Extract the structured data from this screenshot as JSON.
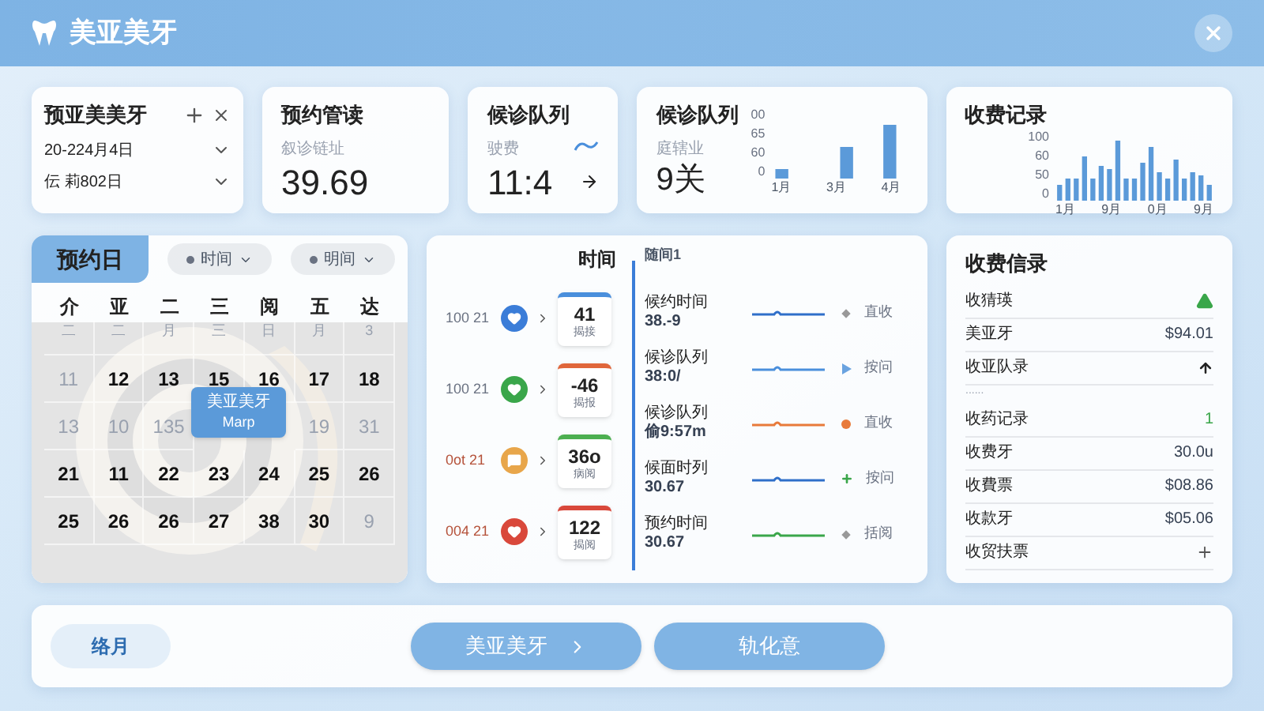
{
  "header": {
    "title": "美亚美牙"
  },
  "booking_card": {
    "title": "预亚美美牙",
    "selects": [
      {
        "value": "20-224月4日"
      },
      {
        "value": "伝 莉802日"
      }
    ]
  },
  "stat_cards": [
    {
      "title": "预约管读",
      "label": "叙诊链址",
      "value": "39.69",
      "kind": "plain"
    },
    {
      "title": "候诊队列",
      "label": "驶费",
      "value": "11:4",
      "kind": "trend"
    }
  ],
  "queue_chart": {
    "title": "候诊队列",
    "label": "庭辖业",
    "value": "9关",
    "yticks": [
      "00",
      "65",
      "60",
      "0"
    ],
    "xlabels": [
      "1月",
      "3月",
      "4月"
    ]
  },
  "fee_chart": {
    "title": "收费记录",
    "yticks": [
      "100",
      "60",
      "50",
      "0"
    ],
    "xlabels": [
      "1月",
      "9月",
      "0月",
      "9月"
    ]
  },
  "calendar": {
    "tab": "预约日",
    "filters": [
      {
        "label": "时间"
      },
      {
        "label": "明间"
      }
    ],
    "weekdays": [
      "介",
      "亚",
      "二",
      "三",
      "阅",
      "五",
      "达"
    ],
    "rows": [
      [
        {
          "text": "二",
          "muted": true,
          "kind": "small"
        },
        {
          "text": "二",
          "muted": true,
          "kind": "small"
        },
        {
          "text": "月",
          "muted": true,
          "kind": "small"
        },
        {
          "text": "三",
          "muted": true,
          "kind": "small"
        },
        {
          "text": "日",
          "muted": true,
          "kind": "small"
        },
        {
          "text": "月",
          "muted": true,
          "kind": "small"
        },
        {
          "text": "3",
          "muted": true,
          "kind": "small"
        }
      ],
      [
        {
          "text": "11",
          "muted": true,
          "kind": "date"
        },
        {
          "text": "12",
          "muted": false,
          "kind": "date"
        },
        {
          "text": "13",
          "muted": false,
          "kind": "date"
        },
        {
          "text": "15",
          "muted": false,
          "kind": "date"
        },
        {
          "text": "16",
          "muted": false,
          "kind": "date"
        },
        {
          "text": "17",
          "muted": false,
          "kind": "date"
        },
        {
          "text": "18",
          "muted": false,
          "kind": "date"
        }
      ],
      [
        {
          "text": "13",
          "muted": true,
          "kind": "date"
        },
        {
          "text": "10",
          "muted": true,
          "kind": "date"
        },
        {
          "text": "135",
          "muted": true,
          "kind": "date"
        },
        {
          "kind": "covered"
        },
        {
          "kind": "covered"
        },
        {
          "text": "19",
          "muted": true,
          "kind": "date"
        },
        {
          "text": "31",
          "muted": true,
          "kind": "date"
        }
      ],
      [
        {
          "text": "21",
          "muted": false,
          "kind": "date"
        },
        {
          "text": "11",
          "muted": false,
          "kind": "date"
        },
        {
          "text": "22",
          "muted": false,
          "kind": "date"
        },
        {
          "text": "23",
          "muted": false,
          "kind": "date"
        },
        {
          "text": "24",
          "muted": false,
          "kind": "date"
        },
        {
          "text": "25",
          "muted": false,
          "kind": "date"
        },
        {
          "text": "26",
          "muted": false,
          "kind": "date"
        }
      ],
      [
        {
          "text": "25",
          "muted": false,
          "kind": "date"
        },
        {
          "text": "26",
          "muted": false,
          "kind": "date"
        },
        {
          "text": "26",
          "muted": false,
          "kind": "date"
        },
        {
          "text": "27",
          "muted": false,
          "kind": "date"
        },
        {
          "text": "38",
          "muted": false,
          "kind": "date"
        },
        {
          "text": "30",
          "muted": false,
          "kind": "date"
        },
        {
          "text": "9",
          "muted": true,
          "kind": "date"
        }
      ]
    ],
    "event": {
      "title": "美亚美牙",
      "subtitle": "Marp"
    }
  },
  "timeline": {
    "title": "时间",
    "subtitle": "随间1",
    "appointments": [
      {
        "time": "100 21",
        "late": false,
        "icon": {
          "kind": "heart",
          "color": "#3b7dd8"
        },
        "tile": {
          "count": "41",
          "tag": "揭接",
          "color": "#4a8fdc"
        }
      },
      {
        "time": "100 21",
        "late": false,
        "icon": {
          "kind": "heart",
          "color": "#3aa64a"
        },
        "tile": {
          "count": "-46",
          "tag": "揭报",
          "color": "#e0663a"
        }
      },
      {
        "time": "0ot 21",
        "late": true,
        "icon": {
          "kind": "message",
          "color": "#e8a64a"
        },
        "tile": {
          "count": "36o",
          "tag": "病阅",
          "color": "#4caf50"
        }
      },
      {
        "time": "004 21",
        "late": true,
        "icon": {
          "kind": "heart",
          "color": "#d9483b"
        },
        "tile": {
          "count": "122",
          "tag": "揭阅",
          "color": "#d9483b"
        }
      }
    ],
    "entries": [
      {
        "title": "候约时间",
        "value": "38.-9",
        "color": "#2f6fc9",
        "kind": "diamond",
        "status": "直收"
      },
      {
        "title": "候诊队列",
        "value": "38:0/",
        "color": "#4a8fdc",
        "kind": "arrow",
        "status": "按问"
      },
      {
        "title": "候诊队列",
        "value": "偷9:57m",
        "color": "#e87a3a",
        "kind": "dot",
        "status": "直收"
      },
      {
        "title": "候面时列",
        "value": "30.67",
        "color": "#2f6fc9",
        "kind": "plus",
        "status": "按问"
      },
      {
        "title": "预约时间",
        "value": "30.67",
        "color": "#3aa64a",
        "kind": "diamond",
        "status": "括阅"
      }
    ]
  },
  "fees": {
    "title": "收费信录",
    "rows": [
      {
        "label": "收猜瑛",
        "kind": "alert"
      },
      {
        "label": "美亚牙",
        "kind": "text",
        "value": "$94.01",
        "highlight": false
      },
      {
        "label": "收亚队录",
        "kind": "up"
      },
      {
        "kind": "dots",
        "value": "......"
      },
      {
        "label": "收药记录",
        "kind": "text",
        "value": "1",
        "highlight": true
      },
      {
        "label": "收费牙",
        "kind": "text",
        "value": "30.0u",
        "highlight": false
      },
      {
        "label": "收費票",
        "kind": "text",
        "value": "$08.86",
        "highlight": false
      },
      {
        "label": "收款牙",
        "kind": "text",
        "value": "$05.06",
        "highlight": false
      },
      {
        "label": "收贸扶票",
        "kind": "plus"
      }
    ]
  },
  "footer": {
    "month": "络月",
    "buttons": [
      {
        "label": "美亚美牙",
        "chevron": true
      },
      {
        "label": "轨化意",
        "chevron": false
      }
    ]
  }
}
